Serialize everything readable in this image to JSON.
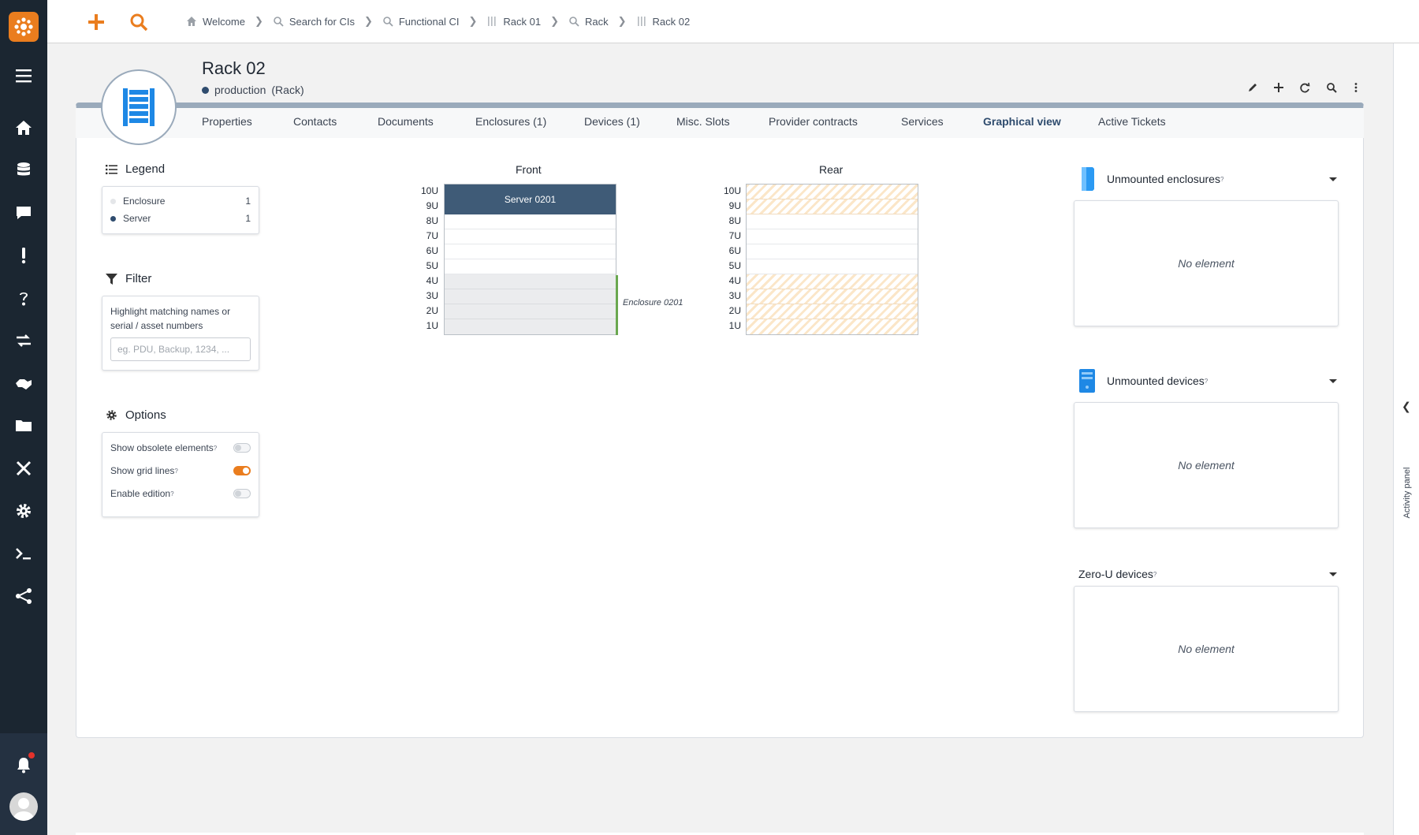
{
  "topbar": {
    "breadcrumb": [
      {
        "label": "Welcome",
        "icon": "home-icon"
      },
      {
        "label": "Search for CIs",
        "icon": "search-icon"
      },
      {
        "label": "Functional CI",
        "icon": "search-icon"
      },
      {
        "label": "Rack 01",
        "icon": "rack-icon"
      },
      {
        "label": "Rack",
        "icon": "search-icon"
      },
      {
        "label": "Rack 02",
        "icon": "rack-icon"
      }
    ],
    "accent_color": "#ea7d1e"
  },
  "object": {
    "title": "Rack 02",
    "status": "production",
    "class": "(Rack)",
    "icon": "rack-icon"
  },
  "tabs": [
    {
      "label": "Properties"
    },
    {
      "label": "Contacts"
    },
    {
      "label": "Documents"
    },
    {
      "label": "Enclosures (1)"
    },
    {
      "label": "Devices (1)"
    },
    {
      "label": "Misc. Slots"
    },
    {
      "label": "Provider contracts"
    },
    {
      "label": "Services"
    },
    {
      "label": "Graphical view"
    },
    {
      "label": "Active Tickets"
    }
  ],
  "legend": {
    "title": "Legend",
    "items": [
      {
        "label": "Enclosure",
        "count": "1",
        "color": "#e4e6e9"
      },
      {
        "label": "Server",
        "count": "1",
        "color": "#2f4c6e"
      }
    ]
  },
  "filter": {
    "title": "Filter",
    "description": "Highlight matching names or serial / asset numbers",
    "placeholder": "eg. PDU, Backup, 1234, ..."
  },
  "options": {
    "title": "Options",
    "items": [
      {
        "label": "Show obsolete elements",
        "help": "?",
        "on": false
      },
      {
        "label": "Show grid lines",
        "help": "?",
        "on": true
      },
      {
        "label": "Enable edition",
        "help": "?",
        "on": false
      }
    ]
  },
  "rack": {
    "front_title": "Front",
    "rear_title": "Rear",
    "units": [
      "10U",
      "9U",
      "8U",
      "7U",
      "6U",
      "5U",
      "4U",
      "3U",
      "2U",
      "1U"
    ],
    "front_server": "Server 0201",
    "enclosure_label": "Enclosure 0201"
  },
  "right_panels": {
    "unmounted_enclosures": {
      "title": "Unmounted enclosures",
      "help": "?",
      "empty": "No element"
    },
    "unmounted_devices": {
      "title": "Unmounted devices",
      "help": "?",
      "empty": "No element"
    },
    "zero_u_devices": {
      "title": "Zero-U devices",
      "help": "?",
      "empty": "No element"
    }
  },
  "activity_panel": {
    "label": "Activity panel"
  }
}
